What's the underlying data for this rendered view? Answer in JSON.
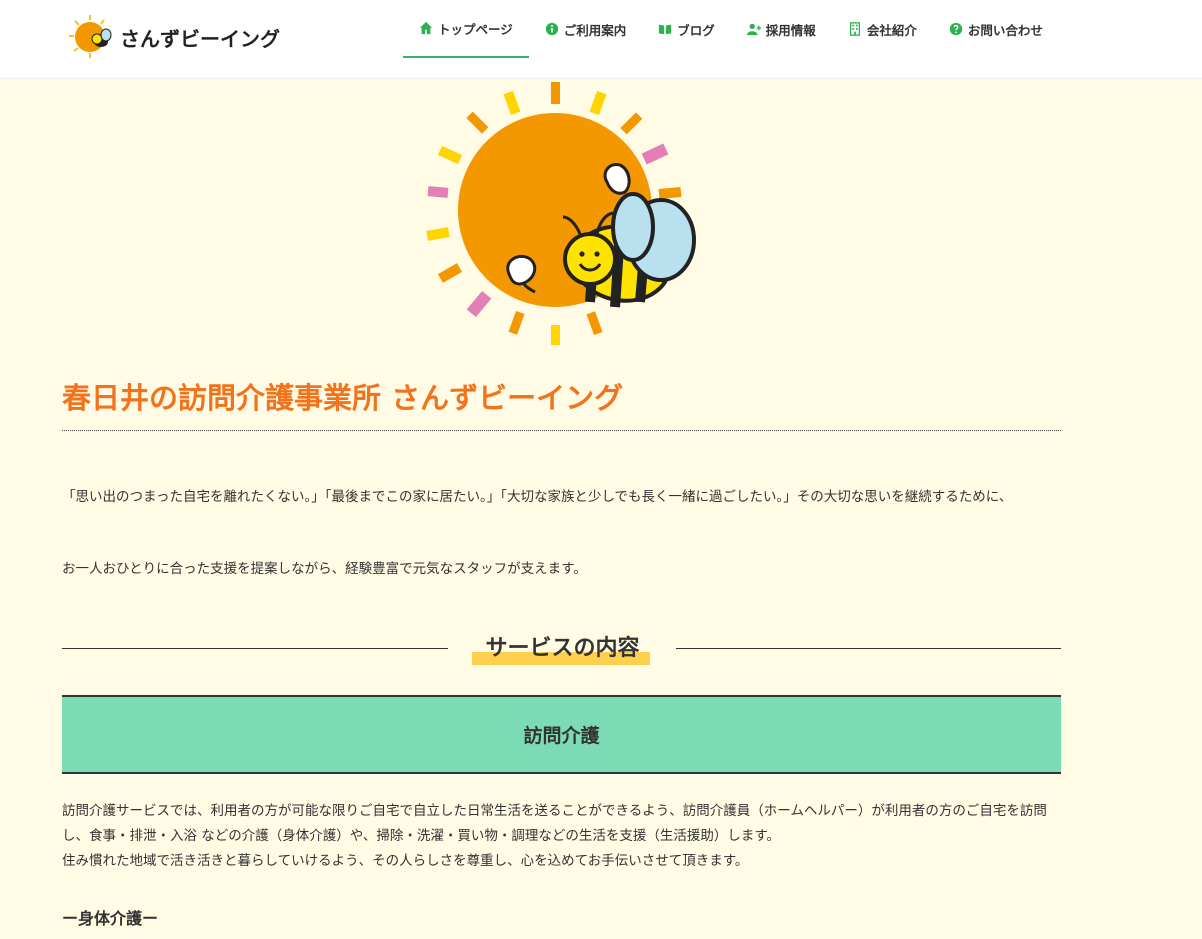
{
  "header": {
    "logo_text": "さんずビーイング",
    "nav": [
      {
        "label": "トップページ",
        "icon": "home-icon"
      },
      {
        "label": "ご利用案内",
        "icon": "info-circle-icon"
      },
      {
        "label": "ブログ",
        "icon": "book-icon"
      },
      {
        "label": "採用情報",
        "icon": "user-plus-icon"
      },
      {
        "label": "会社紹介",
        "icon": "building-icon"
      },
      {
        "label": "お問い合わせ",
        "icon": "question-circle-icon"
      }
    ],
    "active_index": 0
  },
  "colors": {
    "accent": "#3aaf6e",
    "icon_green": "#2bb24c",
    "title_orange": "#f2731c",
    "background": "#fffbe4",
    "service_box": "#7bdbb5",
    "highlight": "#ffd04d"
  },
  "main": {
    "title": "春日井の訪問介護事業所 さんずビーイング",
    "intro_lines": [
      "「思い出のつまった自宅を離れたくない。」「最後までこの家に居たい。」「大切な家族と少しでも長く一緒に過ごしたい。」その大切な思いを継続するために、",
      "お一人おひとりに合った支援を提案しながら、経験豊富で元気なスタッフが支えます。"
    ],
    "section_title": "サービスの内容",
    "service_name": "訪問介護",
    "service_desc_1": "訪問介護サービスでは、利用者の方が可能な限りご自宅で自立した日常生活を送ることができるよう、訪問介護員（ホームヘルパー）が利用者の方のご自宅を訪問し、食事・排泄・入浴 などの介護（身体介護）や、掃除・洗濯・買い物・調理などの生活を支援（生活援助）します。",
    "service_desc_2": "住み慣れた地域で活き活きと暮らしていけるよう、その人らしさを尊重し、心を込めてお手伝いさせて頂きます。",
    "sub_heading": "ー身体介護ー"
  }
}
